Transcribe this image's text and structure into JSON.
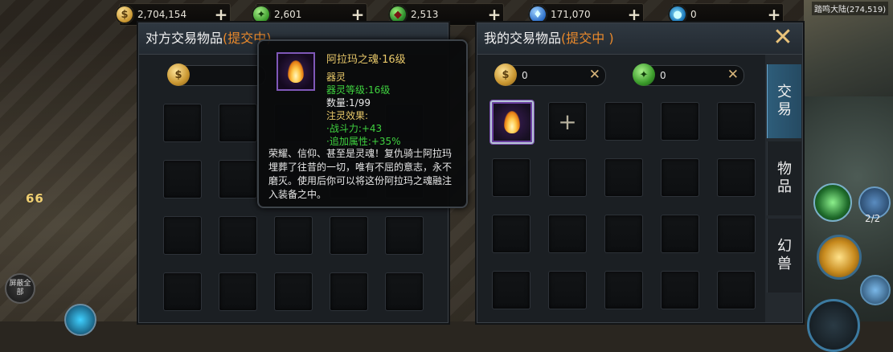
{
  "currencies": [
    {
      "icon": "gold-coin-icon",
      "value": "2,704,154"
    },
    {
      "icon": "jade-icon",
      "value": "2,601"
    },
    {
      "icon": "red-gem-icon",
      "value": "2,513"
    },
    {
      "icon": "crystal-icon",
      "value": "171,070"
    },
    {
      "icon": "blue-orb-icon",
      "value": "0"
    }
  ],
  "currency_add_label": "+",
  "other_panel": {
    "title": "对方交易物品",
    "state": "(提交中)"
  },
  "my_panel": {
    "title": "我的交易物品",
    "state": "(提交中 )",
    "gold_value": "0",
    "jade_value": "0",
    "add_label": "+"
  },
  "close_label": "✕",
  "tabs": [
    {
      "label_top": "交",
      "label_bottom": "易",
      "active": true
    },
    {
      "label_top": "物",
      "label_bottom": "品",
      "active": false
    },
    {
      "label_top": "幻",
      "label_bottom": "兽",
      "active": false
    }
  ],
  "tooltip": {
    "name": "阿拉玛之魂·16级",
    "type": "器灵",
    "level": "器灵等级:16级",
    "quantity": "数量:1/99",
    "effect_title": "注灵效果:",
    "effect_1": "·战斗力:+43",
    "effect_2": "·追加属性:+35%",
    "description": "荣耀、信仰、甚至是灵魂！复仇骑士阿拉玛埋葬了往昔的一切，唯有不屈的意志，永不磨灭。使用后你可以将这份阿拉玛之魂融注入装备之中。"
  },
  "hud": {
    "level_text": "66",
    "mask_button": "屏蔽全部",
    "map_name": "踏鸣大陆(274,519)",
    "page_indicator": "2/2"
  }
}
